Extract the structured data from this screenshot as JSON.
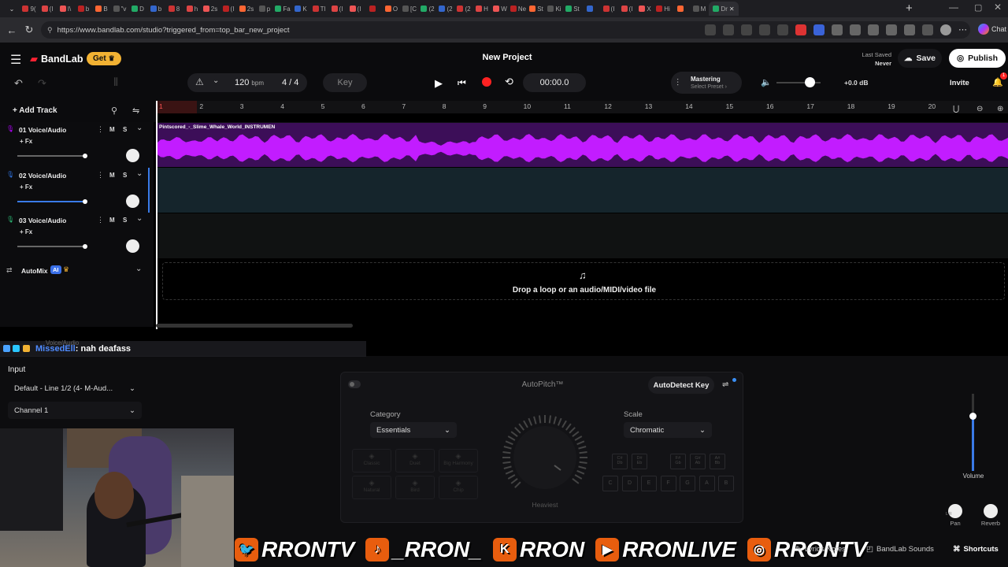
{
  "browser": {
    "url": "https://www.bandlab.com/studio?triggered_from=top_bar_new_project",
    "tabs": [
      "9(",
      "(I",
      "I\\",
      "b",
      "B",
      "\"v",
      "D",
      "b",
      "8",
      "h",
      "2s",
      "(I",
      "2s",
      "p",
      "Fa",
      "K",
      "Tl",
      "(I",
      "(I",
      "",
      "O",
      "[C",
      "(2",
      "(2",
      "(2",
      "H",
      "W",
      "Ne",
      "St",
      "Ki",
      "St",
      "",
      "(I",
      "(I",
      "X",
      "Hi",
      "",
      "M",
      "Dr"
    ],
    "active_tab": "Dr",
    "chat_label": "Chat"
  },
  "header": {
    "app_name": "BandLab",
    "get_label": "Get",
    "project_title": "New Project",
    "last_saved_label": "Last Saved",
    "last_saved_value": "Never",
    "save_label": "Save",
    "publish_label": "Publish",
    "invite_label": "Invite",
    "notif_count": "1"
  },
  "transport": {
    "tempo": "120",
    "tempo_unit": "bpm",
    "time_sig": "4 / 4",
    "key_label": "Key",
    "time": "00:00.0",
    "mastering_label": "Mastering",
    "mastering_sub": "Select Preset",
    "master_volume": "+0.0 dB"
  },
  "tracks_panel": {
    "add_track": "Add Track",
    "tracks": [
      {
        "name": "01  Voice/Audio",
        "fx": "+ Fx",
        "m": "M",
        "s": "S",
        "color": "#b300ff"
      },
      {
        "name": "02  Voice/Audio",
        "fx": "+ Fx",
        "m": "M",
        "s": "S",
        "color": "#2d6fd9"
      },
      {
        "name": "03  Voice/Audio",
        "fx": "+ Fx",
        "m": "M",
        "s": "S",
        "color": "#2bb673"
      }
    ],
    "automix_label": "AutoMix",
    "automix_badge": "AI"
  },
  "ruler": [
    "1",
    "2",
    "3",
    "4",
    "5",
    "6",
    "7",
    "8",
    "9",
    "10",
    "11",
    "12",
    "13",
    "14",
    "15",
    "16",
    "17",
    "18",
    "19",
    "20"
  ],
  "clip": {
    "title": "Pintscored_-_Slime_Whale_World_INSTRUMEN",
    "color": "#b300ff"
  },
  "drop_zone": "Drop a loop or an audio/MIDI/video file",
  "chat_overlay": {
    "user": "MissedEll",
    "message": ": nah deafass",
    "ghost": "Voice/Audio"
  },
  "input_panel": {
    "label": "Input",
    "device": "Default - Line 1/2 (4- M-Aud...",
    "channel": "Channel 1"
  },
  "autopitch": {
    "title": "AutoPitch™",
    "detect_label": "AutoDetect Key",
    "category_label": "Category",
    "category_value": "Essentials",
    "presets": [
      "Classic",
      "Duet",
      "Big Harmony",
      "Natural",
      "Bird",
      "Chip"
    ],
    "knob_label": "Heaviest",
    "scale_label": "Scale",
    "scale_value": "Chromatic",
    "sharp_keys": [
      "C#\nDb",
      "D#\nEb",
      "F#\nGb",
      "G#\nAb",
      "A#\nBb"
    ],
    "natural_keys": [
      "C",
      "D",
      "E",
      "F",
      "G",
      "A",
      "B"
    ]
  },
  "right_panel": {
    "volume_label": "Volume",
    "pan_label": "Pan",
    "reverb_label": "Reverb",
    "pan_lr": "L R"
  },
  "footer": {
    "lyrics": "Lyrics/Notes",
    "sounds": "BandLab Sounds",
    "shortcuts": "Shortcuts"
  },
  "socials": [
    {
      "icon": "twitter-icon",
      "handle": "RRONTV",
      "color": "#e85d0e"
    },
    {
      "icon": "tiktok-icon",
      "handle": "_RRON_",
      "color": "#e85d0e"
    },
    {
      "icon": "kick-icon",
      "handle": "RRON",
      "color": "#e85d0e"
    },
    {
      "icon": "youtube-icon",
      "handle": "RRONLIVE",
      "color": "#e85d0e"
    },
    {
      "icon": "instagram-icon",
      "handle": "RRONTV",
      "color": "#e85d0e"
    }
  ]
}
